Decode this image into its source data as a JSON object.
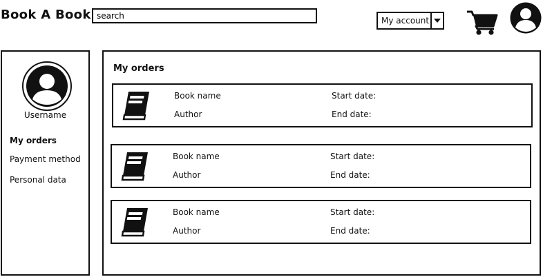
{
  "header": {
    "logo": "Book A Book",
    "search_value": "search",
    "account_select": "My account",
    "cart_icon": "cart-icon",
    "profile_icon": "user-avatar-icon"
  },
  "sidebar": {
    "username": "Username",
    "items": [
      {
        "label": "My orders",
        "active": true
      },
      {
        "label": "Payment method",
        "active": false
      },
      {
        "label": "Personal data",
        "active": false
      }
    ]
  },
  "main": {
    "title": "My orders",
    "orders": [
      {
        "book_name": "Book name",
        "author": "Author",
        "start_date": "Start date:",
        "end_date": "End date:"
      },
      {
        "book_name": "Book name",
        "author": "Author",
        "start_date": "Start date:",
        "end_date": "End date:"
      },
      {
        "book_name": "Book name",
        "author": "Author",
        "start_date": "Start date:",
        "end_date": "End date:"
      }
    ]
  }
}
